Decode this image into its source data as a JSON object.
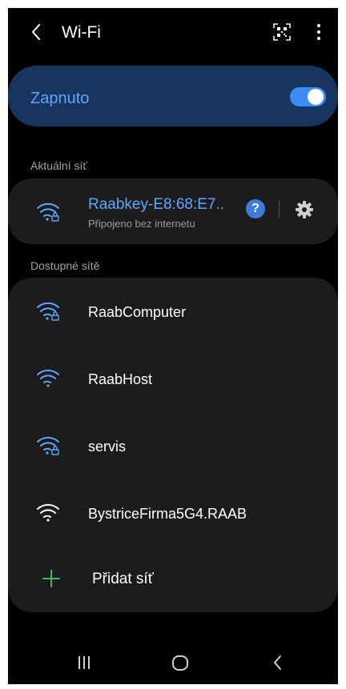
{
  "header": {
    "title": "Wi-Fi",
    "back_icon": "chevron-left-icon",
    "qr_icon": "qr-scan-icon",
    "more_icon": "more-vert-icon"
  },
  "master_toggle": {
    "label": "Zapnuto",
    "state": "on"
  },
  "current_section": {
    "heading": "Aktuální síť",
    "network": {
      "name": "Raabkey-E8:68:E7..",
      "status": "Připojeno bez internetu",
      "help_glyph": "?",
      "secured": true
    }
  },
  "available_section": {
    "heading": "Dostupné sítě",
    "networks": [
      {
        "name": "RaabComputer",
        "secured": true
      },
      {
        "name": "RaabHost",
        "secured": false
      },
      {
        "name": "servis",
        "secured": true
      },
      {
        "name": "BystriceFirma5G4.RAAB",
        "secured": false
      }
    ],
    "add_label": "Přidat síť"
  },
  "navbar": {
    "items": [
      "recents-icon",
      "home-icon",
      "back-icon"
    ]
  },
  "colors": {
    "background": "#000000",
    "accent": "#3e8cf5",
    "accent_text": "#5fa6ff",
    "card": "#1c1c1c",
    "toggle_card": "#17355e",
    "add_icon": "#3fb950"
  }
}
